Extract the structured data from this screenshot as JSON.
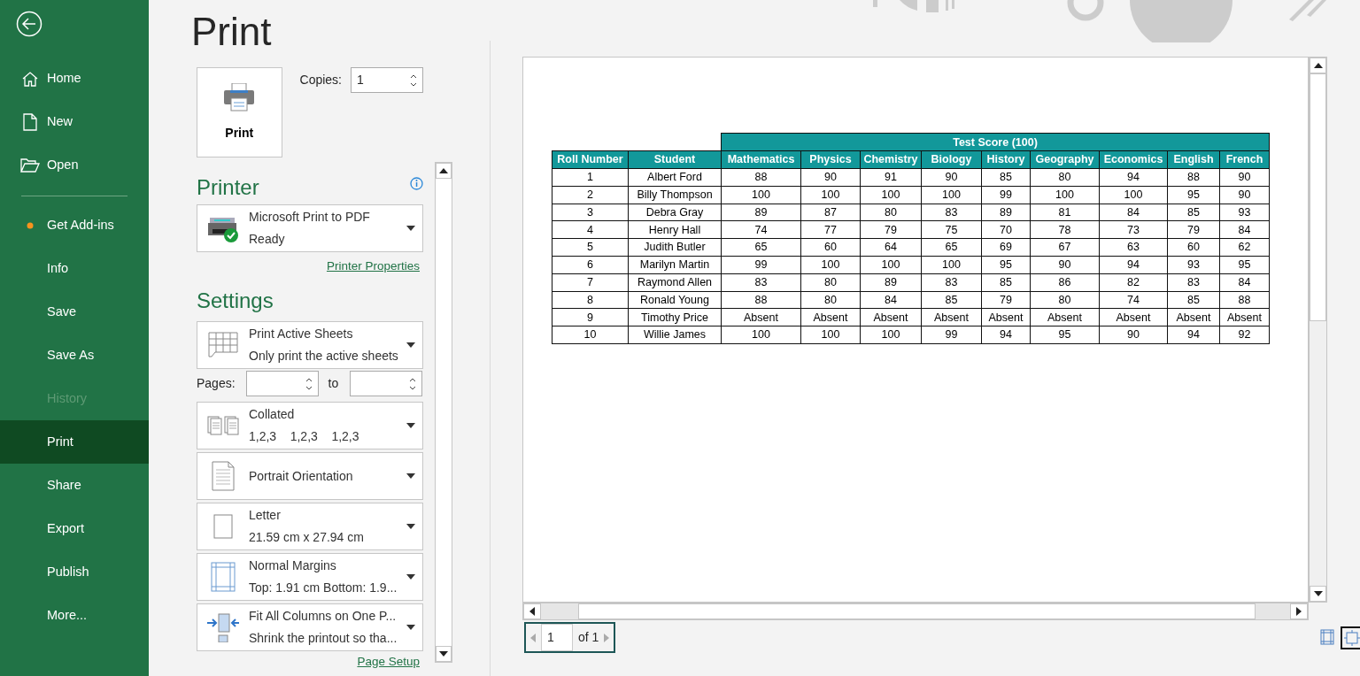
{
  "nav": {
    "groups": [
      [
        {
          "label": "Home",
          "kind": "home",
          "selected": false,
          "disabled": false
        },
        {
          "label": "New",
          "kind": "new",
          "selected": false,
          "disabled": false
        },
        {
          "label": "Open",
          "kind": "open",
          "selected": false,
          "disabled": false
        }
      ],
      [
        {
          "label": "Get Add-ins",
          "kind": "dot",
          "selected": false,
          "disabled": false
        },
        {
          "label": "Info",
          "kind": "plain",
          "selected": false,
          "disabled": false
        },
        {
          "label": "Save",
          "kind": "plain",
          "selected": false,
          "disabled": false
        },
        {
          "label": "Save As",
          "kind": "plain",
          "selected": false,
          "disabled": false
        },
        {
          "label": "History",
          "kind": "plain",
          "selected": false,
          "disabled": true
        },
        {
          "label": "Print",
          "kind": "plain",
          "selected": true,
          "disabled": false
        },
        {
          "label": "Share",
          "kind": "plain",
          "selected": false,
          "disabled": false
        },
        {
          "label": "Export",
          "kind": "plain",
          "selected": false,
          "disabled": false
        },
        {
          "label": "Publish",
          "kind": "plain",
          "selected": false,
          "disabled": false
        },
        {
          "label": "More...",
          "kind": "plain",
          "selected": false,
          "disabled": false
        }
      ]
    ]
  },
  "title": "Print",
  "print_button": "Print",
  "copies": {
    "label": "Copies:",
    "value": "1"
  },
  "printer": {
    "heading": "Printer",
    "name": "Microsoft Print to PDF",
    "status": "Ready",
    "link": "Printer Properties"
  },
  "settings": {
    "heading": "Settings",
    "items": [
      {
        "kind": "dropdown",
        "line1": "Print Active Sheets",
        "line2": "Only print the active sheets"
      },
      {
        "kind": "pages",
        "label": "Pages:",
        "to": "to"
      },
      {
        "kind": "dropdown",
        "line1": "Collated",
        "line2": "1,2,3    1,2,3    1,2,3"
      },
      {
        "kind": "dropdown",
        "line1": "Portrait Orientation"
      },
      {
        "kind": "dropdown",
        "line1": "Letter",
        "line2": "21.59 cm x 27.94 cm"
      },
      {
        "kind": "dropdown",
        "line1": "Normal Margins",
        "line2": "Top: 1.91 cm Bottom: 1.9..."
      },
      {
        "kind": "dropdown",
        "line1": "Fit All Columns on One P...",
        "line2": "Shrink the printout so tha..."
      }
    ],
    "link": "Page Setup"
  },
  "preview": {
    "table": {
      "group_header": "Test Score (100)",
      "columns": [
        "Roll Number",
        "Student",
        "Mathematics",
        "Physics",
        "Chemistry",
        "Biology",
        "History",
        "Geography",
        "Economics",
        "English",
        "French"
      ],
      "rows": [
        [
          "1",
          "Albert Ford",
          "88",
          "90",
          "91",
          "90",
          "85",
          "80",
          "94",
          "88",
          "90"
        ],
        [
          "2",
          "Billy Thompson",
          "100",
          "100",
          "100",
          "100",
          "99",
          "100",
          "100",
          "95",
          "90"
        ],
        [
          "3",
          "Debra Gray",
          "89",
          "87",
          "80",
          "83",
          "89",
          "81",
          "84",
          "85",
          "93"
        ],
        [
          "4",
          "Henry Hall",
          "74",
          "77",
          "79",
          "75",
          "70",
          "78",
          "73",
          "79",
          "84"
        ],
        [
          "5",
          "Judith Butler",
          "65",
          "60",
          "64",
          "65",
          "69",
          "67",
          "63",
          "60",
          "62"
        ],
        [
          "6",
          "Marilyn Martin",
          "99",
          "100",
          "100",
          "100",
          "95",
          "90",
          "94",
          "93",
          "95"
        ],
        [
          "7",
          "Raymond Allen",
          "83",
          "80",
          "89",
          "83",
          "85",
          "86",
          "82",
          "83",
          "84"
        ],
        [
          "8",
          "Ronald Young",
          "88",
          "80",
          "84",
          "85",
          "79",
          "80",
          "74",
          "85",
          "88"
        ],
        [
          "9",
          "Timothy Price",
          "Absent",
          "Absent",
          "Absent",
          "Absent",
          "Absent",
          "Absent",
          "Absent",
          "Absent",
          "Absent"
        ],
        [
          "10",
          "Willie James",
          "100",
          "100",
          "100",
          "99",
          "94",
          "95",
          "90",
          "94",
          "92"
        ]
      ]
    },
    "page": "1",
    "page_of": "of 1",
    "views": [
      {
        "kind": "margins",
        "selected": false
      },
      {
        "kind": "zoom",
        "selected": true
      }
    ]
  }
}
